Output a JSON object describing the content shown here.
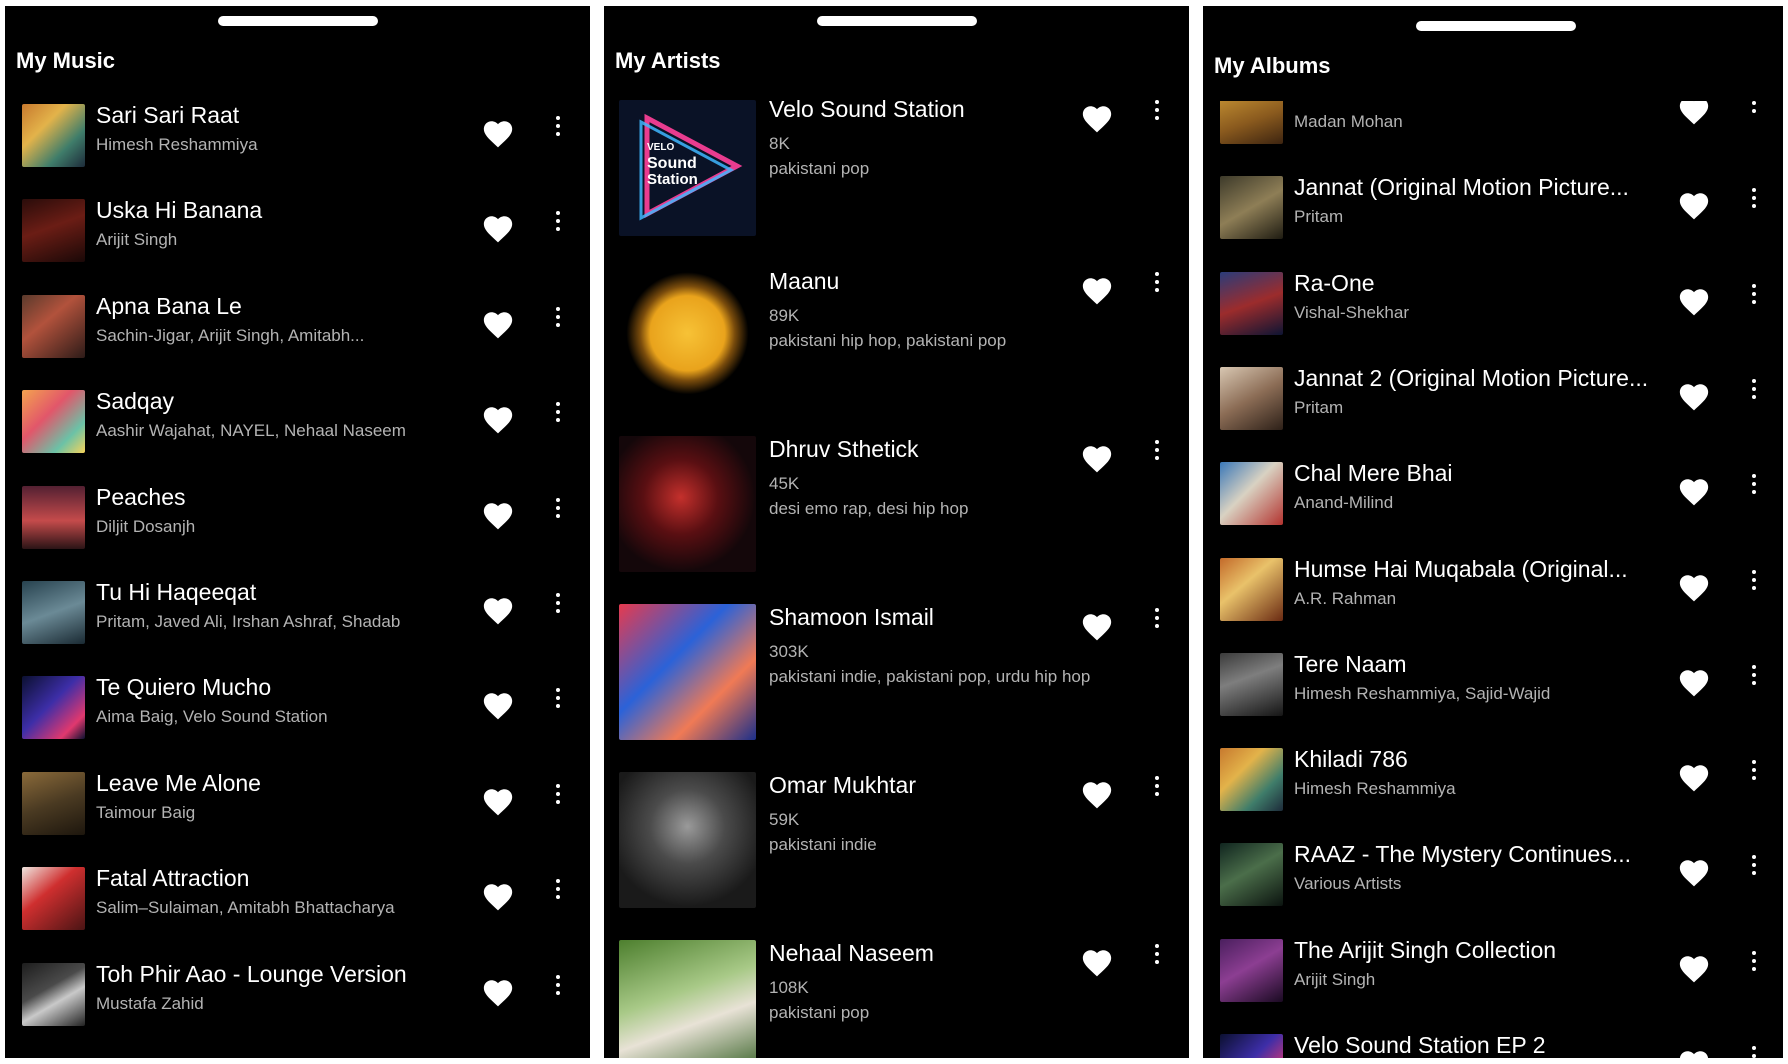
{
  "music": {
    "title": "My Music",
    "songs": [
      {
        "title": "Sari Sari Raat",
        "artists": "Himesh Reshammiya",
        "art": "khiladi-cover"
      },
      {
        "title": "Uska Hi Banana",
        "artists": "Arijit Singh",
        "art": "dark-red-cover"
      },
      {
        "title": "Apna Bana Le",
        "artists": "Sachin-Jigar, Arijit Singh, Amitabh...",
        "art": "bhediya-cover"
      },
      {
        "title": "Sadqay",
        "artists": "Aashir Wajahat, NAYEL, Nehaal Naseem",
        "art": "colorful-cover"
      },
      {
        "title": "Peaches",
        "artists": "Diljit Dosanjh",
        "art": "sunset-cover"
      },
      {
        "title": "Tu Hi Haqeeqat",
        "artists": "Pritam, Javed Ali, Irshan Ashraf, Shadab",
        "art": "tum-mile-cover"
      },
      {
        "title": "Te Quiero Mucho",
        "artists": "Aima Baig, Velo Sound Station",
        "art": "velo-cover"
      },
      {
        "title": "Leave Me Alone",
        "artists": "Taimour Baig",
        "art": "sepia-cover"
      },
      {
        "title": "Fatal Attraction",
        "artists": "Salim–Sulaiman, Amitabh Bhattacharya",
        "art": "red-cover"
      },
      {
        "title": "Toh Phir Aao - Lounge Version",
        "artists": "Mustafa Zahid",
        "art": "awarapan-cover"
      }
    ]
  },
  "artists": {
    "title": "My Artists",
    "items": [
      {
        "name": "Velo Sound Station",
        "followers": "8K",
        "genres": "pakistani pop",
        "art": "velo-logo",
        "logo_text": [
          "VELO",
          "Sound",
          "Station"
        ]
      },
      {
        "name": "Maanu",
        "followers": "89K",
        "genres": "pakistani hip hop, pakistani pop",
        "art": "sun-silhouette"
      },
      {
        "name": "Dhruv Sthetick",
        "followers": "45K",
        "genres": "desi emo rap, desi hip hop",
        "art": "red-portrait"
      },
      {
        "name": "Shamoon Ismail",
        "followers": "303K",
        "genres": "pakistani indie, pakistani pop, urdu hip hop",
        "art": "neon-portrait"
      },
      {
        "name": "Omar Mukhtar",
        "followers": "59K",
        "genres": "pakistani indie",
        "art": "bw-portrait"
      },
      {
        "name": "Nehaal Naseem",
        "followers": "108K",
        "genres": "pakistani pop",
        "art": "green-portrait"
      }
    ]
  },
  "albums": {
    "title": "My Albums",
    "items": [
      {
        "title": "",
        "artists": "Madan Mohan",
        "art": "veer-zaara-cover"
      },
      {
        "title": "Jannat (Original Motion Picture...",
        "artists": "Pritam",
        "art": "jannat-cover"
      },
      {
        "title": "Ra-One",
        "artists": "Vishal-Shekhar",
        "art": "raone-cover"
      },
      {
        "title": "Jannat 2 (Original Motion Picture...",
        "artists": "Pritam",
        "art": "jannat2-cover"
      },
      {
        "title": "Chal Mere Bhai",
        "artists": "Anand-Milind",
        "art": "chal-mere-bhai-cover"
      },
      {
        "title": "Humse Hai Muqabala (Original...",
        "artists": "A.R. Rahman",
        "art": "muqabala-cover"
      },
      {
        "title": "Tere Naam",
        "artists": "Himesh Reshammiya, Sajid-Wajid",
        "art": "tere-naam-cover"
      },
      {
        "title": "Khiladi 786",
        "artists": "Himesh Reshammiya",
        "art": "khiladi-cover"
      },
      {
        "title": "RAAZ - The Mystery Continues...",
        "artists": "Various Artists",
        "art": "raaz-cover"
      },
      {
        "title": "The Arijit Singh Collection",
        "artists": "Arijit Singh",
        "art": "arijit-cover"
      },
      {
        "title": "Velo Sound Station EP 2",
        "artists": "",
        "art": "velo-ep-cover"
      }
    ]
  },
  "colors": {
    "background": "#000000",
    "text_primary": "#ffffff",
    "text_secondary": "#b3b3b3",
    "icon": "#ffffff"
  },
  "icons": {
    "like": "heart-icon",
    "more": "kebab-menu-icon",
    "drag": "drag-handle"
  }
}
